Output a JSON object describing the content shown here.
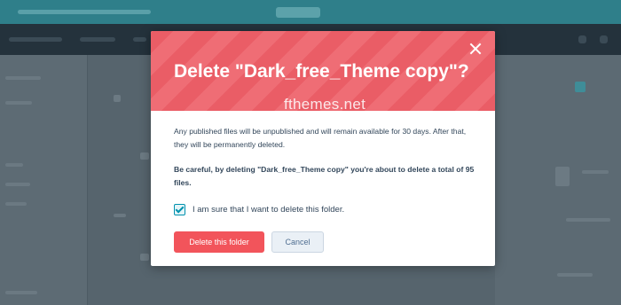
{
  "modal": {
    "title": "Delete \"Dark_free_Theme copy\"?",
    "watermark": "fthemes.net",
    "description": "Any published files will be unpublished and will remain available for 30 days. After that, they will be permanently deleted.",
    "warning": "Be careful, by deleting \"Dark_free_Theme copy\" you're about to delete a total of 95 files.",
    "checkbox_label": "I am sure that I want to delete this folder.",
    "checkbox_checked": true,
    "delete_label": "Delete this folder",
    "cancel_label": "Cancel",
    "close_icon": "close-icon"
  },
  "colors": {
    "header": "#ea5d66",
    "delete_button": "#f2545b",
    "checkbox": "#0091ae",
    "text": "#33475b"
  }
}
